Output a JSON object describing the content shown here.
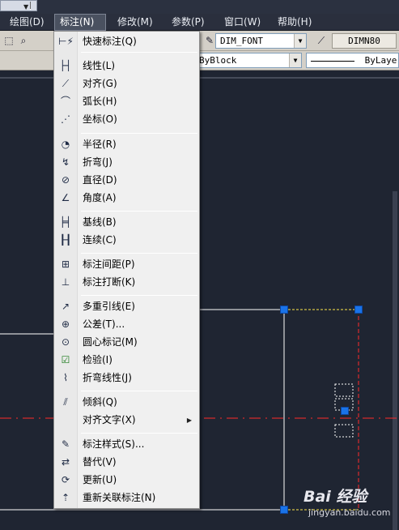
{
  "menubar": {
    "items": [
      {
        "label": "绘图(D)"
      },
      {
        "label": "标注(N)"
      },
      {
        "label": "修改(M)"
      },
      {
        "label": "参数(P)"
      },
      {
        "label": "窗口(W)"
      },
      {
        "label": "帮助(H)"
      }
    ],
    "active_index": 1
  },
  "toolbar": {
    "text_style": "DIM_FONT",
    "dim_style": "DIMN80",
    "linetype": "ByBlock",
    "lineweight": "ByLayer"
  },
  "dimension_menu": {
    "items": [
      {
        "label": "快速标注(Q)",
        "icon": "quick-dimension-icon"
      },
      {
        "label": "线性(L)",
        "icon": "linear-dimension-icon"
      },
      {
        "label": "对齐(G)",
        "icon": "aligned-dimension-icon"
      },
      {
        "label": "弧长(H)",
        "icon": "arc-length-icon"
      },
      {
        "label": "坐标(O)",
        "icon": "ordinate-icon"
      },
      {
        "label": "半径(R)",
        "icon": "radius-icon"
      },
      {
        "label": "折弯(J)",
        "icon": "jogged-icon"
      },
      {
        "label": "直径(D)",
        "icon": "diameter-icon"
      },
      {
        "label": "角度(A)",
        "icon": "angular-icon"
      },
      {
        "label": "基线(B)",
        "icon": "baseline-icon"
      },
      {
        "label": "连续(C)",
        "icon": "continue-icon"
      },
      {
        "label": "标注间距(P)",
        "icon": "dimension-space-icon"
      },
      {
        "label": "标注打断(K)",
        "icon": "dimension-break-icon"
      },
      {
        "label": "多重引线(E)",
        "icon": "multileader-icon"
      },
      {
        "label": "公差(T)...",
        "icon": "tolerance-icon"
      },
      {
        "label": "圆心标记(M)",
        "icon": "center-mark-icon"
      },
      {
        "label": "检验(I)",
        "icon": "inspection-icon"
      },
      {
        "label": "折弯线性(J)",
        "icon": "jogged-linear-icon"
      },
      {
        "label": "倾斜(Q)",
        "icon": "oblique-icon"
      },
      {
        "label": "对齐文字(X)",
        "icon": ""
      },
      {
        "label": "标注样式(S)...",
        "icon": "dimension-style-icon"
      },
      {
        "label": "替代(V)",
        "icon": "override-icon"
      },
      {
        "label": "更新(U)",
        "icon": "update-icon"
      },
      {
        "label": "重新关联标注(N)",
        "icon": "reassociate-icon"
      }
    ]
  },
  "watermark": {
    "logo": "Bai 经验",
    "url": "jingyan.baidu.com"
  },
  "colors": {
    "canvas": "#1f2532",
    "grip": "#1a73e8",
    "dashed_red": "#ff2a2a",
    "dashed_yellow": "#ffe84a",
    "line_white": "#ffffff"
  }
}
